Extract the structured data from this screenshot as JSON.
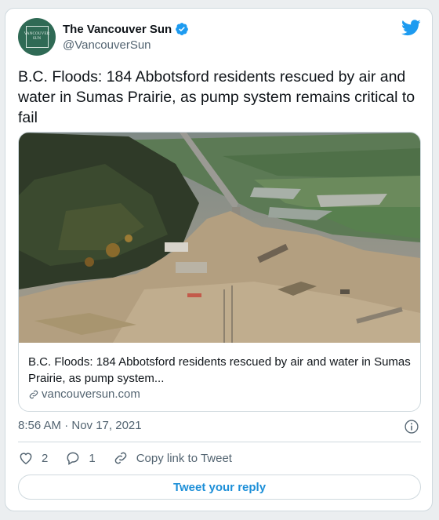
{
  "account": {
    "display_name": "The Vancouver Sun",
    "handle": "@VancouverSun",
    "avatar_text_line1": "VANCOUVER",
    "avatar_text_line2": "SUN",
    "verified": true
  },
  "tweet": {
    "text": "B.C. Floods: 184 Abbotsford residents rescued by air and water in Sumas Prairie, as pump system remains critical to fail",
    "timestamp": "8:56 AM · Nov 17, 2021"
  },
  "link_card": {
    "title": "B.C. Floods: 184 Abbotsford residents rescued by air and water in Sumas Prairie, as pump system...",
    "domain": "vancouversun.com",
    "image": "aerial-flood-photo"
  },
  "actions": {
    "like_count": "2",
    "reply_count": "1",
    "copy_link_label": "Copy link to Tweet"
  },
  "reply_button_label": "Tweet your reply",
  "colors": {
    "accent": "#1d9bf0",
    "secondary_text": "#536471",
    "border": "#cfd9de",
    "avatar_bg": "#2f6a55"
  }
}
